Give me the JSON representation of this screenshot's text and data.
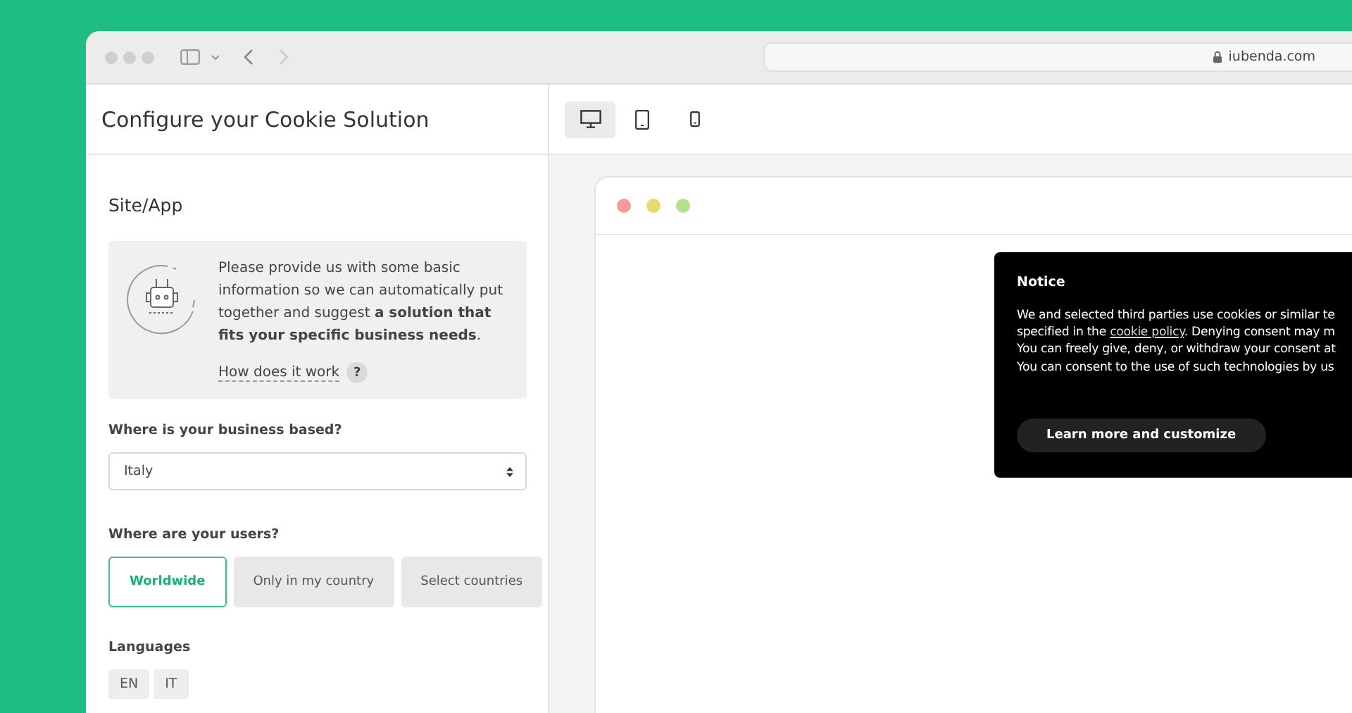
{
  "browser": {
    "url": "iubenda.com"
  },
  "sidebar": {
    "title": "Configure your Cookie Solution",
    "section": "Site/App",
    "info": {
      "text": "Please provide us with some basic information so we can automatically put together and suggest **a solution that fits your specific business needs**.",
      "link": "How does it work",
      "help": "?"
    },
    "business": {
      "label": "Where is your business based?",
      "value": "Italy"
    },
    "users": {
      "label": "Where are your users?",
      "options": [
        {
          "label": "Worldwide",
          "selected": true
        },
        {
          "label": "Only in my country",
          "selected": false
        },
        {
          "label": "Select countries",
          "selected": false
        }
      ]
    },
    "languages": {
      "label": "Languages",
      "items": [
        {
          "label": "EN"
        },
        {
          "label": "IT"
        }
      ]
    }
  },
  "preview": {
    "devices": [
      {
        "kind": "desktop",
        "selected": true
      },
      {
        "kind": "tablet",
        "selected": false
      },
      {
        "kind": "phone",
        "selected": false
      }
    ],
    "notice": {
      "title": "Notice",
      "lines": [
        {
          "text": "We and selected third parties use cookies or similar te"
        },
        {
          "before": "specified in the ",
          "link": "cookie policy",
          "after": ". Denying consent may m"
        },
        {
          "text": "You can freely give, deny, or withdraw your consent at"
        },
        {
          "text": "You can consent to the use of such technologies by us"
        }
      ],
      "button": "Learn more and customize"
    }
  }
}
